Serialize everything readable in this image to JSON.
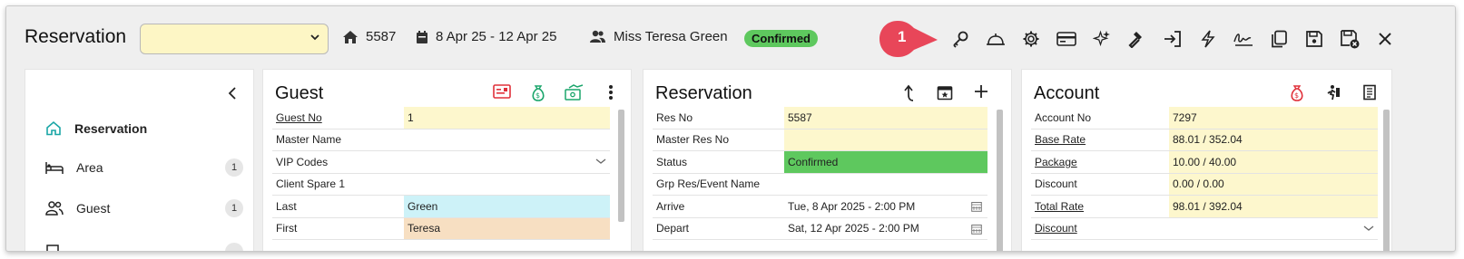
{
  "header": {
    "title": "Reservation",
    "select_value": "",
    "room": "5587",
    "dates": "8 Apr 25 - 12 Apr 25",
    "guest": "Miss Teresa Green",
    "status": "Confirmed",
    "callout_number": "1",
    "toolbar_icons": [
      "key-icon",
      "bell-icon",
      "gear-icon",
      "credit-card-icon",
      "sparkle-icon",
      "hammer-icon",
      "sign-in-icon",
      "lightning-icon",
      "signature-icon",
      "copy-icon",
      "save-icon",
      "save-close-icon",
      "close-icon"
    ]
  },
  "nav": {
    "items": [
      {
        "label": "Reservation",
        "icon": "home-icon",
        "count": ""
      },
      {
        "label": "Area",
        "icon": "bed-icon",
        "count": "1"
      },
      {
        "label": "Guest",
        "icon": "people-icon",
        "count": "1"
      }
    ]
  },
  "guest": {
    "title": "Guest",
    "rows": [
      {
        "label": "Guest No",
        "value": "1"
      },
      {
        "label": "Master Name",
        "value": ""
      },
      {
        "label": "VIP Codes",
        "value": ""
      },
      {
        "label": "Client Spare 1",
        "value": ""
      },
      {
        "label": "Last",
        "value": "Green"
      },
      {
        "label": "First",
        "value": "Teresa"
      }
    ]
  },
  "reservation": {
    "title": "Reservation",
    "rows": [
      {
        "label": "Res No",
        "value": "5587"
      },
      {
        "label": "Master Res No",
        "value": ""
      },
      {
        "label": "Status",
        "value": "Confirmed"
      },
      {
        "label": "Grp Res/Event Name",
        "value": ""
      },
      {
        "label": "Arrive",
        "value": "Tue, 8 Apr 2025 - 2:00 PM"
      },
      {
        "label": "Depart",
        "value": "Sat, 12 Apr 2025 - 2:00 PM"
      }
    ]
  },
  "account": {
    "title": "Account",
    "rows": [
      {
        "label": "Account No",
        "value": "7297"
      },
      {
        "label": "Base Rate",
        "value": "88.01 / 352.04"
      },
      {
        "label": "Package",
        "value": "10.00 / 40.00"
      },
      {
        "label": "Discount",
        "value": "0.00 / 0.00"
      },
      {
        "label": "Total Rate",
        "value": "98.01 / 392.04"
      },
      {
        "label": "Discount",
        "value": ""
      }
    ]
  },
  "colors": {
    "confirmed": "#5ec85e",
    "field_yellow": "#fdf7cd",
    "field_cyan": "#cdf2f8",
    "field_peach": "#f7dfc2",
    "callout_red": "#e84659",
    "nav_accent": "#1aa6a6"
  }
}
